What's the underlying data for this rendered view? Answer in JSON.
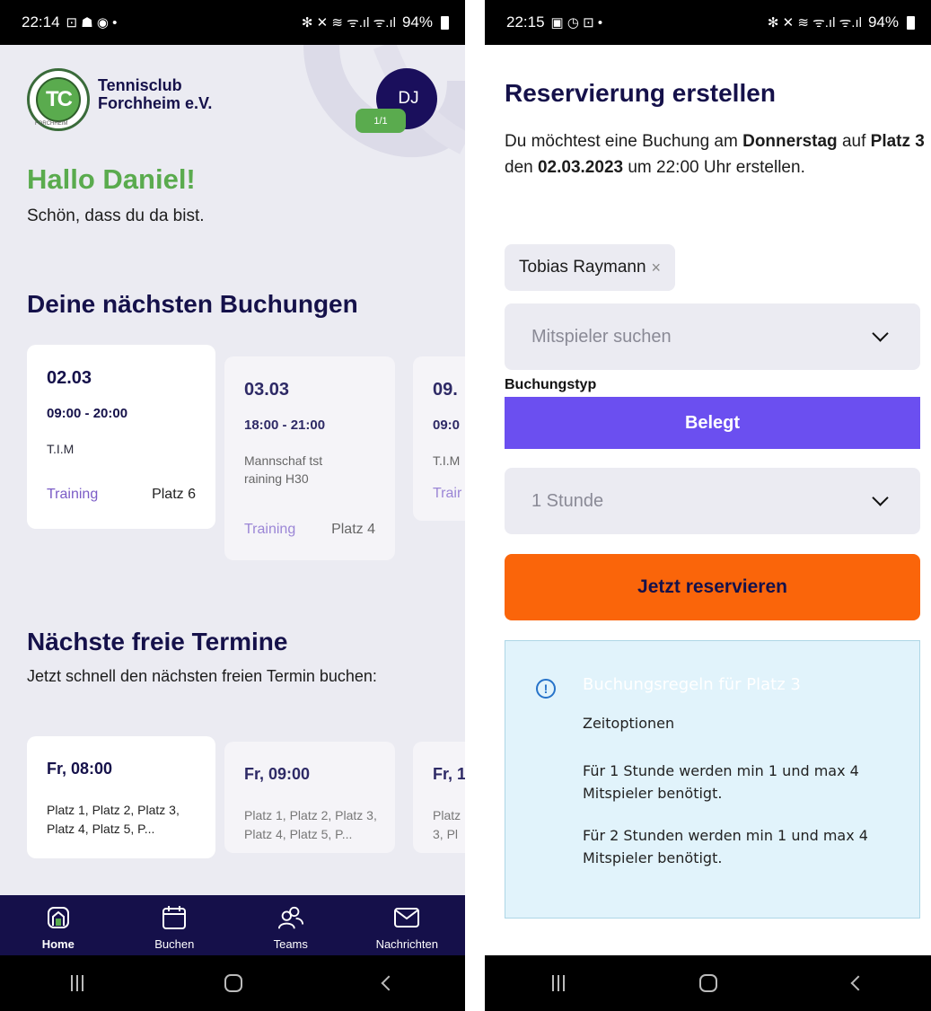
{
  "left_screen": {
    "status_bar": {
      "time": "22:14",
      "left_icons": "⊡ ☗ ◉ •",
      "right_icons": "✻ ✕ ≋ ᯤ.ıl ᯤ.ıl",
      "battery": "94%"
    },
    "header": {
      "logo_text": "TC",
      "logo_ring_text": "FORCHHEIM",
      "club_name_line1": "Tennisclub",
      "club_name_line2": "Forchheim e.V.",
      "avatar_initials": "DJ",
      "avatar_badge": "1/1"
    },
    "greeting": "Hallo Daniel!",
    "greeting_sub": "Schön, dass du da bist.",
    "bookings_title": "Deine nächsten Buchungen",
    "bookings": [
      {
        "date": "02.03",
        "time": "09:00 - 20:00",
        "title": "T.I.M",
        "type": "Training",
        "court": "Platz 6"
      },
      {
        "date": "03.03",
        "time": "18:00 - 21:00",
        "title": "Mannschaf tstraining H30",
        "type": "Training",
        "court": "Platz 4"
      },
      {
        "date": "09.",
        "time": "09:0",
        "title": "T.I.M",
        "type": "Trair",
        "court": ""
      }
    ],
    "free_title": "Nächste freie Termine",
    "free_sub": "Jetzt schnell den nächsten freien Termin buchen:",
    "free_slots": [
      {
        "time": "Fr, 08:00",
        "courts": "Platz 1, Platz 2, Platz 3, Platz 4, Platz 5, P..."
      },
      {
        "time": "Fr, 09:00",
        "courts": "Platz 1, Platz 2, Platz 3, Platz 4, Platz 5, P..."
      },
      {
        "time": "Fr, 1",
        "courts": "Platz 3, Pl"
      }
    ],
    "bottom_nav": [
      {
        "label": "Home",
        "icon": "home-icon",
        "active": true
      },
      {
        "label": "Buchen",
        "icon": "calendar-icon",
        "active": false
      },
      {
        "label": "Teams",
        "icon": "teams-icon",
        "active": false
      },
      {
        "label": "Nachrichten",
        "icon": "mail-icon",
        "active": false
      }
    ]
  },
  "right_screen": {
    "status_bar": {
      "time": "22:15",
      "left_icons": "▣ ◷ ⊡ •",
      "right_icons": "✻ ✕ ≋ ᯤ.ıl ᯤ.ıl",
      "battery": "94%"
    },
    "title": "Reservierung erstellen",
    "intro": {
      "part1": "Du möchtest eine Buchung am ",
      "weekday": "Donnerstag",
      "part2": " auf ",
      "court": "Platz 3",
      "part3": " den ",
      "date": "02.03.2023",
      "part4": " um 22:00 Uhr erstellen."
    },
    "player_chip": "Tobias Raymann",
    "player_chip_remove": "×",
    "player_search_placeholder": "Mitspieler suchen",
    "booking_type_label": "Buchungstyp",
    "booking_type_button": "Belegt",
    "duration_value": "1 Stunde",
    "reserve_button": "Jetzt reservieren",
    "info": {
      "icon": "!",
      "title": "Buchungsregeln für Platz 3",
      "subtitle": "Zeitoptionen",
      "rules": [
        "Für 1 Stunde werden min 1 und max 4 Mitspieler benötigt.",
        "Für 2 Stunden werden min 1 und max 4 Mitspieler benötigt."
      ]
    }
  },
  "colors": {
    "navy": "#15114a",
    "green": "#5aab4e",
    "purple": "#6b4ff0",
    "orange": "#fa650a",
    "info_bg": "#e1f3fb"
  }
}
